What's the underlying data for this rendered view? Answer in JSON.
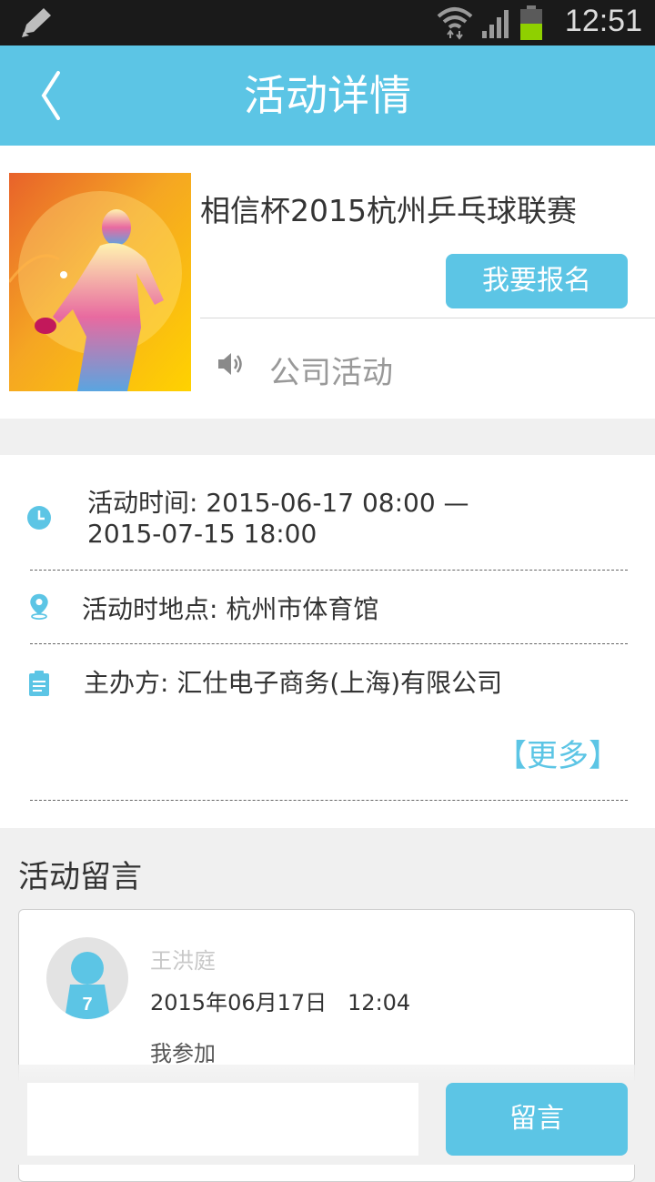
{
  "status_bar": {
    "time": "12:51",
    "icons": [
      "edit-icon",
      "wifi-icon",
      "signal-icon",
      "battery-icon"
    ]
  },
  "header": {
    "title": "活动详情",
    "back_icon": "chevron-left-icon"
  },
  "event": {
    "title": "相信杯2015杭州乒乓球联赛",
    "signup_label": "我要报名",
    "category": "公司活动",
    "image": "table-tennis-player-poster"
  },
  "info": {
    "time_line1": "活动时间: 2015-06-17 08:00 —",
    "time_line2": "2015-07-15 18:00",
    "location": "活动时地点: 杭州市体育馆",
    "organizer": "主办方: 汇仕电子商务(上海)有限公司",
    "more_label": "【更多】"
  },
  "comments": {
    "title": "活动留言",
    "items": [
      {
        "user": "王洪庭",
        "time": "2015年06月17日   12:04",
        "text": "我参加",
        "avatar_badge": "7"
      }
    ]
  },
  "composer": {
    "input_value": "",
    "input_placeholder": "",
    "button_label": "留言"
  },
  "colors": {
    "accent": "#5cc5e5",
    "status_bar": "#1a1a1a",
    "background": "#f0f0f0"
  }
}
